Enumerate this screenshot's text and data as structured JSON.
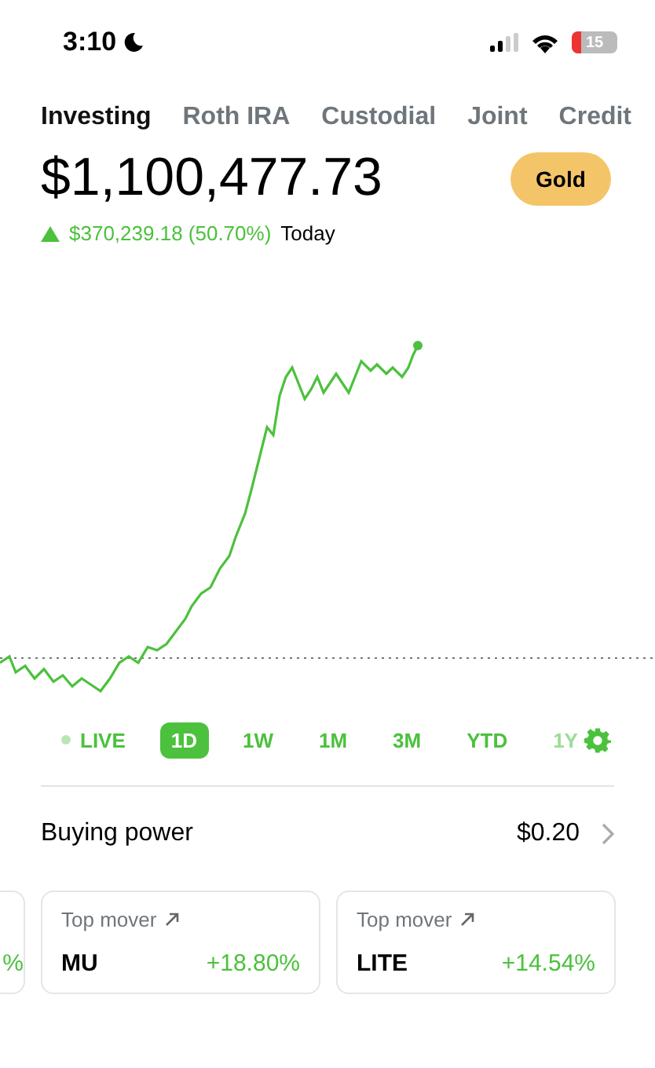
{
  "status_bar": {
    "time": "3:10",
    "battery": "15"
  },
  "tabs": [
    {
      "label": "Investing",
      "selected": true
    },
    {
      "label": "Roth IRA",
      "selected": false
    },
    {
      "label": "Custodial",
      "selected": false
    },
    {
      "label": "Joint",
      "selected": false
    },
    {
      "label": "Credit",
      "selected": false
    }
  ],
  "balance": "$1,100,477.73",
  "membership_badge": "Gold",
  "change": {
    "amount": "$370,239.18 (50.70%)",
    "period": "Today"
  },
  "ranges": [
    {
      "label": "LIVE",
      "kind": "live",
      "selected": false
    },
    {
      "label": "1D",
      "kind": "range",
      "selected": true
    },
    {
      "label": "1W",
      "kind": "range",
      "selected": false
    },
    {
      "label": "1M",
      "kind": "range",
      "selected": false
    },
    {
      "label": "3M",
      "kind": "range",
      "selected": false
    },
    {
      "label": "YTD",
      "kind": "range",
      "selected": false
    },
    {
      "label": "1Y",
      "kind": "range",
      "selected": false
    }
  ],
  "buying_power": {
    "label": "Buying power",
    "value": "$0.20"
  },
  "cards": [
    {
      "kind": "partial",
      "change": "%"
    },
    {
      "kind": "full",
      "title": "Top mover",
      "symbol": "MU",
      "change": "+18.80%"
    },
    {
      "kind": "full",
      "title": "Top mover",
      "symbol": "LITE",
      "change": "+14.54%"
    }
  ]
}
